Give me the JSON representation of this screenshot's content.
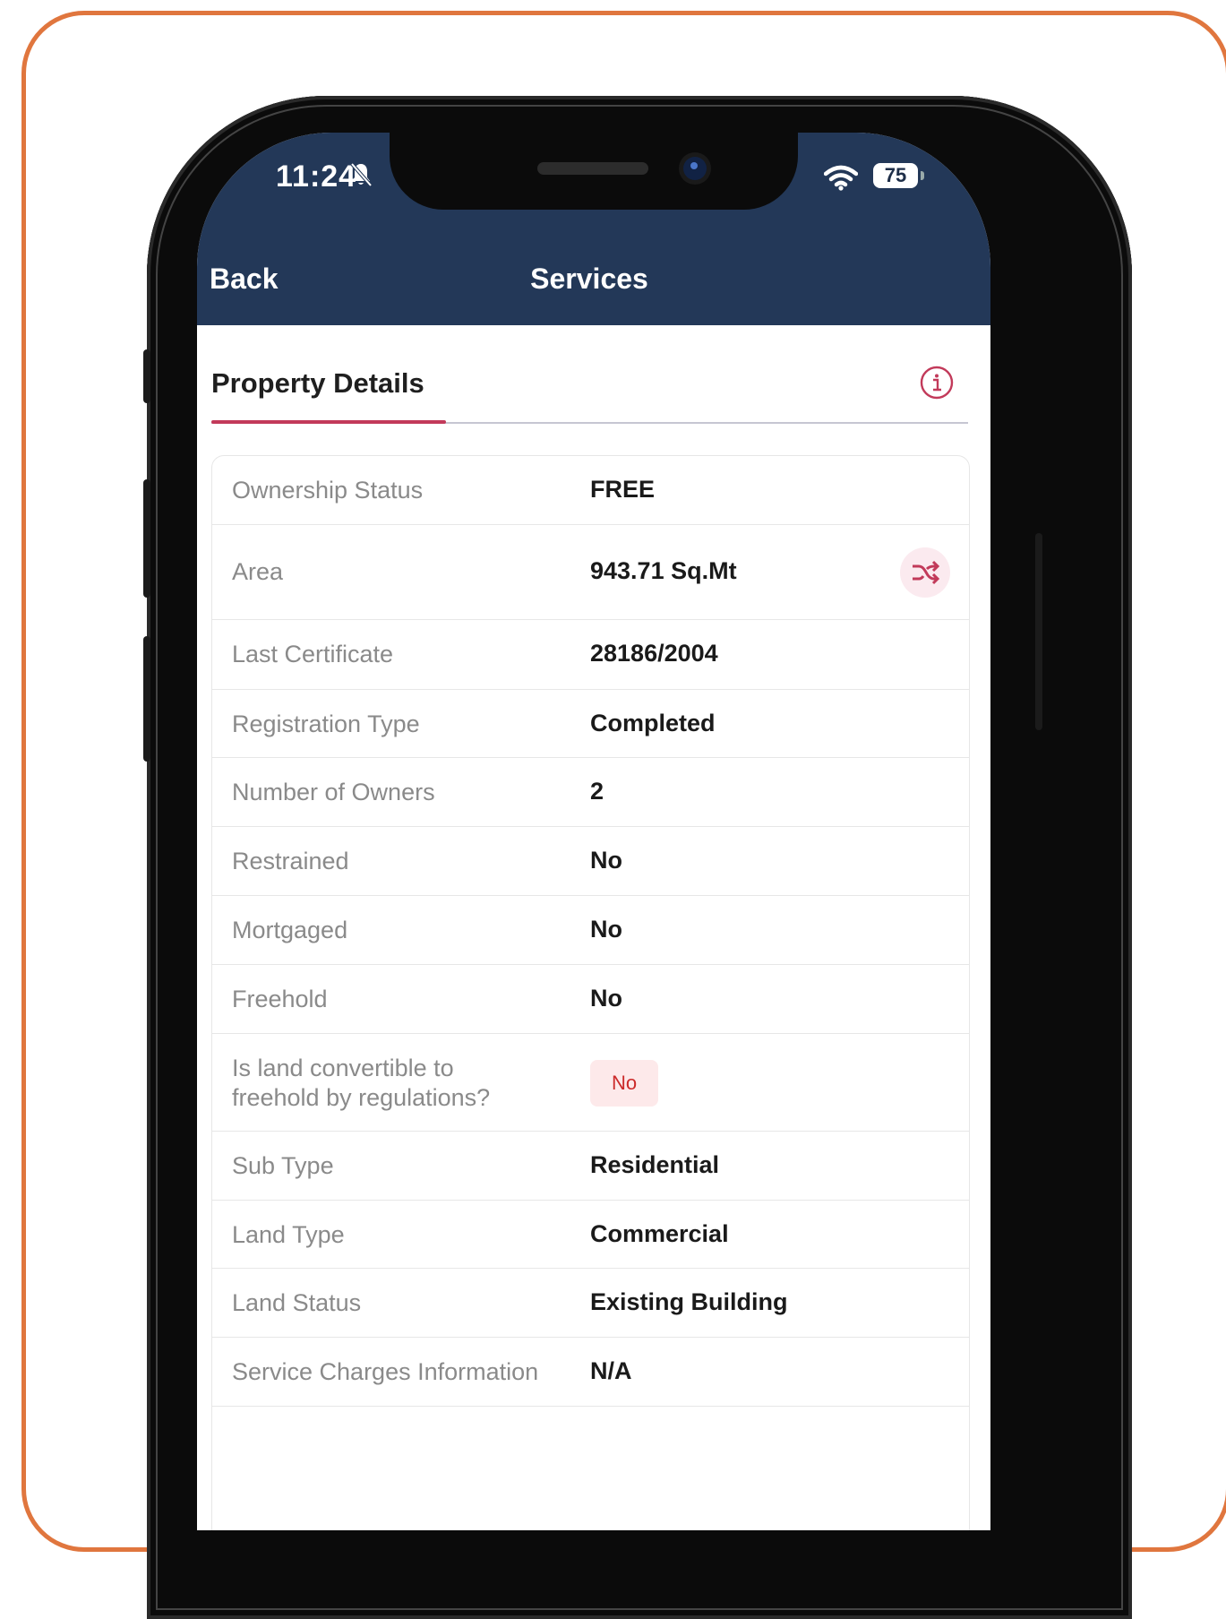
{
  "status_bar": {
    "time": "11:24",
    "battery": "75",
    "icons": [
      "bell-muted-icon",
      "wifi-icon",
      "battery-icon"
    ]
  },
  "nav": {
    "back_label": "Back",
    "title": "Services"
  },
  "section": {
    "title": "Property Details",
    "info_icon": "info-icon"
  },
  "details": {
    "rows": [
      {
        "label": "Ownership Status",
        "value": "FREE"
      },
      {
        "label": "Area",
        "value": "943.71 Sq.Mt",
        "action_icon": "shuffle-icon"
      },
      {
        "label": "Last Certificate",
        "value": "28186/2004"
      },
      {
        "label": "Registration Type",
        "value": "Completed"
      },
      {
        "label": "Number of Owners",
        "value": "2"
      },
      {
        "label": "Restrained",
        "value": "No"
      },
      {
        "label": "Mortgaged",
        "value": "No"
      },
      {
        "label": "Freehold",
        "value": "No"
      },
      {
        "label_line1": "Is land convertible to",
        "label_line2": "freehold by regulations?",
        "badge": "No"
      },
      {
        "label": "Sub Type",
        "value": "Residential"
      },
      {
        "label": "Land Type",
        "value": "Commercial"
      },
      {
        "label": "Land Status",
        "value": "Existing Building"
      },
      {
        "label": "Service Charges Information",
        "value": "N/A"
      }
    ]
  },
  "colors": {
    "frame": "#e0763e",
    "header": "#233858",
    "accent": "#c23a5a",
    "badge_bg": "#fde9ea",
    "badge_text": "#cc2a2a"
  }
}
